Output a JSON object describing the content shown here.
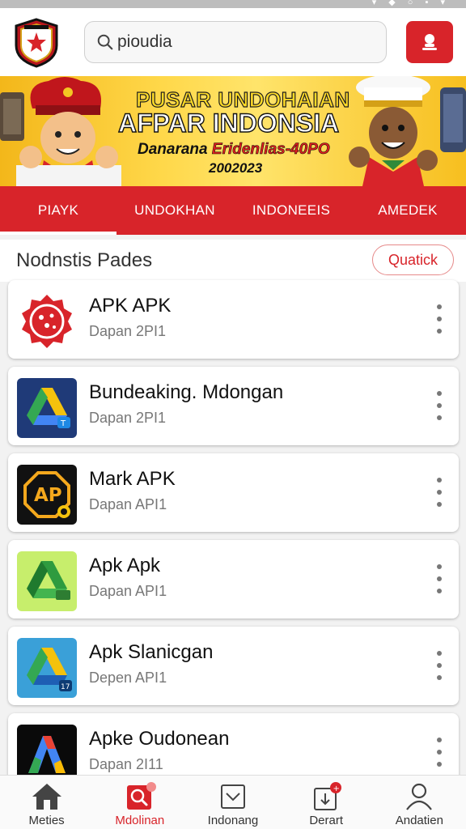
{
  "search": {
    "value": "pioudia",
    "placeholder": "pioudia"
  },
  "banner": {
    "title_line1": "PUSAR UNDOHAIAN",
    "title_line2": "AFPAR INDONSIA",
    "subtitle_a": "Danarana",
    "subtitle_b": "Eridenlias-40PO",
    "year": "2002023"
  },
  "tabs": [
    {
      "label": "PIAYK"
    },
    {
      "label": "UNDOKHAN"
    },
    {
      "label": "INDONEEIS"
    },
    {
      "label": "AMEDEK"
    }
  ],
  "section": {
    "title": "Nodnstis Pades",
    "quick_label": "Quatick"
  },
  "apps": [
    {
      "name": "APK APK",
      "sub": "Dapan 2PI1",
      "icon": "red-badge-icon"
    },
    {
      "name": "Bundeaking. Mdongan",
      "sub": "Dapan 2PI1",
      "icon": "drive-triangle-icon"
    },
    {
      "name": "Mark APK",
      "sub": "Dapan API1",
      "icon": "ap-octagon-icon"
    },
    {
      "name": "Apk Apk",
      "sub": "Dapan API1",
      "icon": "green-drive-icon"
    },
    {
      "name": "Apk Slanicgan",
      "sub": "Depen API1",
      "icon": "blue-drive-icon"
    },
    {
      "name": "Apke Oudonean",
      "sub": "Dapan 2I11",
      "icon": "color-a-icon"
    }
  ],
  "bottom_nav": [
    {
      "label": "Meties",
      "icon": "home-icon"
    },
    {
      "label": "Mdolinan",
      "icon": "search-box-icon"
    },
    {
      "label": "Indonang",
      "icon": "inbox-icon"
    },
    {
      "label": "Derart",
      "icon": "download-badge-icon"
    },
    {
      "label": "Andatien",
      "icon": "person-icon"
    }
  ],
  "colors": {
    "accent": "#d8242a",
    "banner": "#ffd84a",
    "background": "#f2f2f2"
  }
}
